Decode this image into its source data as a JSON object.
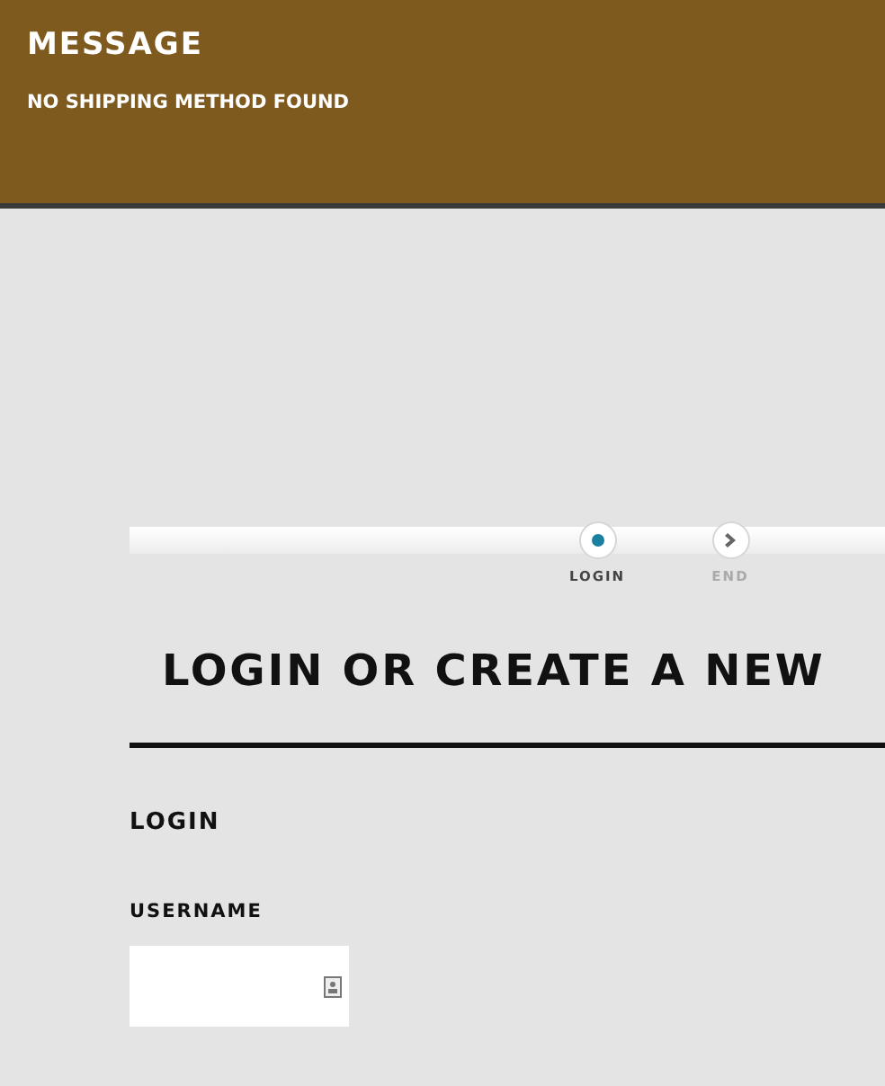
{
  "message": {
    "title": "MESSAGE",
    "text": "NO SHIPPING METHOD FOUND"
  },
  "steps": [
    {
      "label": "LOGIN",
      "selected": true
    },
    {
      "label": "END",
      "selected": false
    }
  ],
  "heading": "LOGIN OR CREATE A NEW",
  "login": {
    "title": "LOGIN",
    "fields": [
      {
        "label": "USERNAME"
      }
    ]
  }
}
